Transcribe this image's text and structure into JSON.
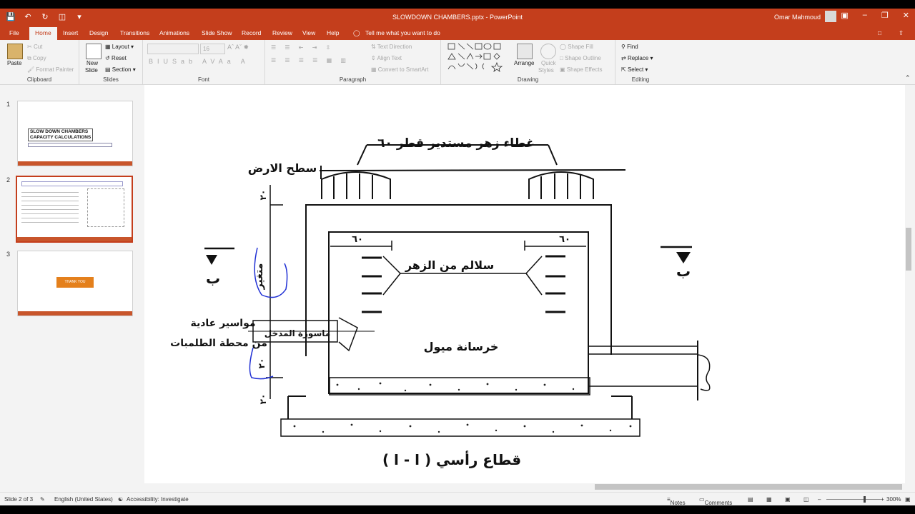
{
  "window": {
    "title": "SLOWDOWN CHAMBERS.pptx  -  PowerPoint",
    "user": "Omar Mahmoud"
  },
  "menu": {
    "tabs": [
      "File",
      "Home",
      "Insert",
      "Design",
      "Transitions",
      "Animations",
      "Slide Show",
      "Record",
      "Review",
      "View",
      "Help"
    ],
    "active": "Home",
    "tell_me": "Tell me what you want to do"
  },
  "ribbon": {
    "clipboard": {
      "label": "Clipboard",
      "paste": "Paste",
      "cut": "Cut",
      "copy": "Copy",
      "format_painter": "Format Painter"
    },
    "slides": {
      "label": "Slides",
      "new_slide": "New",
      "new_slide2": "Slide",
      "layout": "Layout",
      "reset": "Reset",
      "section": "Section"
    },
    "font": {
      "label": "Font",
      "size": "16"
    },
    "paragraph": {
      "label": "Paragraph",
      "text_direction": "Text Direction",
      "align_text": "Align Text",
      "convert": "Convert to SmartArt"
    },
    "drawing": {
      "label": "Drawing",
      "arrange": "Arrange",
      "quick_styles": "Quick",
      "quick_styles2": "Styles",
      "shape_fill": "Shape Fill",
      "shape_outline": "Shape Outline",
      "shape_effects": "Shape Effects"
    },
    "editing": {
      "label": "Editing",
      "find": "Find",
      "replace": "Replace",
      "select": "Select"
    }
  },
  "thumbnails": [
    {
      "num": "1",
      "title1": "SLOW DOWN CHAMBERS",
      "title2": "CAPACITY CALCULATIONS"
    },
    {
      "num": "2"
    },
    {
      "num": "3",
      "button": "THANK YOU"
    }
  ],
  "slide": {
    "cover_label": "غطاء زهر مستدير قطر ٦٠",
    "ground_label": "سطح الارض",
    "ladder_label": "سلالم من الزهر",
    "concrete_label": "خرسانة ميول",
    "pipes_label": "مواسير عادية",
    "station_label": "من محطة الطلمبات",
    "inlet_label": "ماسورة المدخل",
    "variable_label": "متغير",
    "dim_60": "٦٠",
    "dim_20": "٢٠",
    "section_b": "ب",
    "section_title": "قطاع رأسي   ( ا  -  ا )"
  },
  "status": {
    "slide": "Slide 2 of 3",
    "language": "English (United States)",
    "accessibility": "Accessibility: Investigate",
    "notes": "Notes",
    "comments": "Comments",
    "zoom": "300%"
  },
  "colors": {
    "accent": "#c43e1c",
    "ink": "#111111",
    "annotation": "#1f2fd4"
  }
}
